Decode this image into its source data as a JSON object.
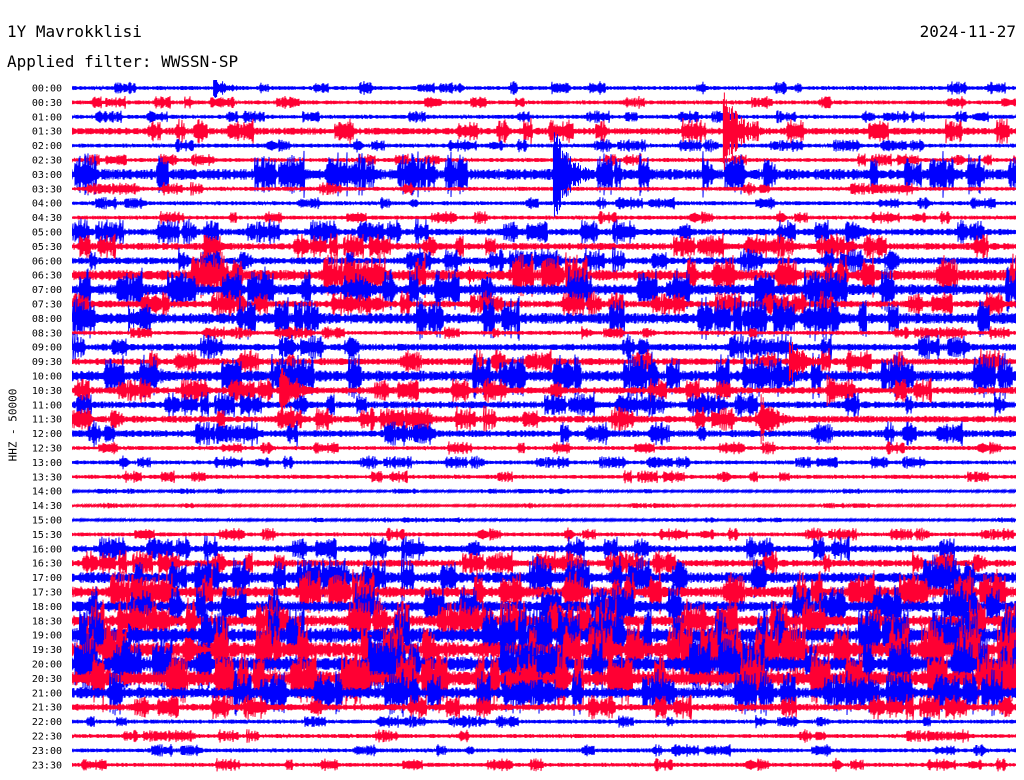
{
  "header": {
    "station": "1Y Mavrokklisi",
    "date": "2024-11-27",
    "filter": "Applied filter: WWSSN-SP"
  },
  "chart_data": {
    "type": "line",
    "title": "1Y Mavrokklisi",
    "ylabel": "HHZ - 50000",
    "series_colors": [
      "#0000ff",
      "#ff0033"
    ],
    "rows": [
      "00:00",
      "00:30",
      "01:00",
      "01:30",
      "02:00",
      "02:30",
      "03:00",
      "03:30",
      "04:00",
      "04:30",
      "05:00",
      "05:30",
      "06:00",
      "06:30",
      "07:00",
      "07:30",
      "08:00",
      "08:30",
      "09:00",
      "09:30",
      "10:00",
      "10:30",
      "11:00",
      "11:30",
      "12:00",
      "12:30",
      "13:00",
      "13:30",
      "14:00",
      "14:30",
      "15:00",
      "15:30",
      "16:00",
      "16:30",
      "17:00",
      "17:30",
      "18:00",
      "18:30",
      "19:00",
      "19:30",
      "20:00",
      "20:30",
      "21:00",
      "21:30",
      "22:00",
      "22:30",
      "23:00",
      "23:30"
    ],
    "activity": [
      1,
      1,
      1,
      2,
      1,
      1,
      3,
      1,
      1,
      1,
      2,
      2,
      2,
      3,
      3,
      2,
      3,
      1,
      2,
      2,
      3,
      2,
      2,
      2,
      2,
      1,
      1,
      1,
      0,
      0,
      0,
      1,
      2,
      2,
      3,
      3,
      3,
      3,
      4,
      4,
      4,
      4,
      3,
      2,
      1,
      1,
      1,
      1
    ],
    "events": [
      {
        "row": 0,
        "t": 0.15,
        "amp": 12
      },
      {
        "row": 2,
        "t": 0.65,
        "amp": 6
      },
      {
        "row": 3,
        "t": 0.69,
        "amp": 45
      },
      {
        "row": 6,
        "t": 0.51,
        "amp": 55
      },
      {
        "row": 10,
        "t": 0.82,
        "amp": 14
      },
      {
        "row": 11,
        "t": 0.14,
        "amp": 14
      },
      {
        "row": 13,
        "t": 0.42,
        "amp": 10
      },
      {
        "row": 14,
        "t": 0.31,
        "amp": 12
      },
      {
        "row": 14,
        "t": 0.63,
        "amp": 12
      },
      {
        "row": 16,
        "t": 0.06,
        "amp": 16
      },
      {
        "row": 18,
        "t": 0.22,
        "amp": 14
      },
      {
        "row": 19,
        "t": 0.76,
        "amp": 24
      },
      {
        "row": 20,
        "t": 0.09,
        "amp": 10
      },
      {
        "row": 21,
        "t": 0.22,
        "amp": 28
      },
      {
        "row": 21,
        "t": 0.8,
        "amp": 16
      },
      {
        "row": 23,
        "t": 0.73,
        "amp": 26
      },
      {
        "row": 24,
        "t": 0.35,
        "amp": 12
      },
      {
        "row": 38,
        "t": 0.06,
        "amp": 14
      },
      {
        "row": 39,
        "t": 0.12,
        "amp": 18
      },
      {
        "row": 41,
        "t": 0.46,
        "amp": 14
      }
    ]
  }
}
